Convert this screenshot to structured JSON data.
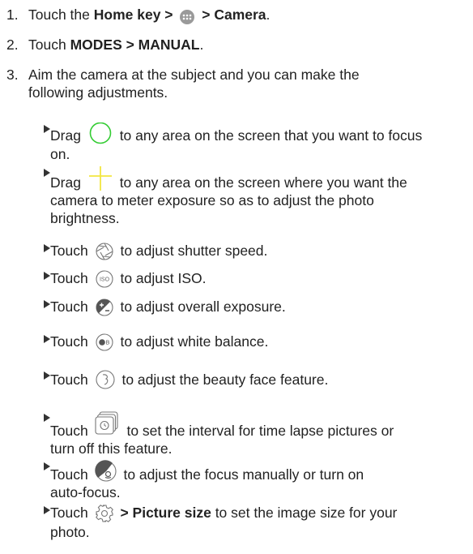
{
  "steps": [
    {
      "num": "1.",
      "pre": "Touch the ",
      "bold1": "Home",
      "bold2": " key > ",
      "icon": "app-drawer-icon",
      "bold3": " > Camera",
      "post": "."
    },
    {
      "num": "2.",
      "pre": "Touch ",
      "bold1": "MODES > MANUAL",
      "post": "."
    },
    {
      "num": "3.",
      "line1": "Aim the camera at the subject and you can make the",
      "line2": "following adjustments."
    }
  ],
  "adjustments": [
    {
      "icon": "focus-circle-icon",
      "color": "#33cc33",
      "pre": "Drag",
      "text": "to any area on the screen that you want to focus",
      "cont": "on."
    },
    {
      "icon": "exposure-cross-icon",
      "color": "#f2e640",
      "pre": "Drag",
      "text": "to any area on the screen where you want the",
      "cont": "camera to meter exposure so as to adjust the photo",
      "cont2": "brightness."
    },
    {
      "icon": "shutter-speed-icon",
      "pre": "Touch",
      "text": "to adjust shutter speed."
    },
    {
      "icon": "iso-icon",
      "icon_text": "ISO",
      "pre": "Touch",
      "text": "to adjust ISO."
    },
    {
      "icon": "exposure-compensation-icon",
      "pre": "Touch",
      "text": "to adjust overall exposure."
    },
    {
      "icon": "white-balance-icon",
      "icon_text": "B",
      "pre": "Touch",
      "text": "to adjust white balance."
    },
    {
      "icon": "beauty-face-icon",
      "pre": "Touch",
      "text": "to adjust the beauty face feature."
    },
    {
      "icon": "time-lapse-icon",
      "pre": "Touch",
      "text": "to set the interval for time lapse pictures or",
      "cont": "turn off this feature."
    },
    {
      "icon": "manual-focus-icon",
      "pre": "Touch",
      "text": "to adjust the focus manually or turn on",
      "cont": "auto-focus."
    },
    {
      "icon": "settings-gear-icon",
      "pre": "Touch",
      "bold": "> Picture size",
      "text": "to set the image size for your",
      "cont": "photo."
    }
  ]
}
